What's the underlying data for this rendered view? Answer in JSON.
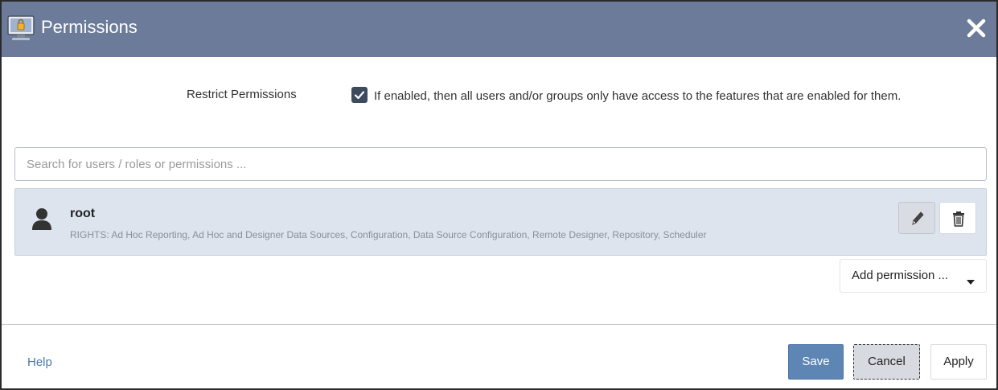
{
  "dialog": {
    "title": "Permissions",
    "close_icon": "close-icon"
  },
  "restrict": {
    "label": "Restrict Permissions",
    "checked": true,
    "description": "If enabled, then all users and/or groups only have access to the features that are enabled for them."
  },
  "search": {
    "placeholder": "Search for users / roles or permissions ...",
    "value": ""
  },
  "permissions": [
    {
      "name": "root",
      "rights": "RIGHTS: Ad Hoc Reporting, Ad Hoc and Designer Data Sources, Configuration, Data Source Configuration, Remote Designer, Repository, Scheduler",
      "icon": "user-icon"
    }
  ],
  "add_permission": {
    "label": "Add permission ..."
  },
  "footer": {
    "help_label": "Help",
    "save_label": "Save",
    "cancel_label": "Cancel",
    "apply_label": "Apply"
  },
  "colors": {
    "titlebar": "#6b7b99",
    "row_bg": "#dde4ee",
    "primary": "#5e86b5",
    "link": "#4a79a8"
  }
}
